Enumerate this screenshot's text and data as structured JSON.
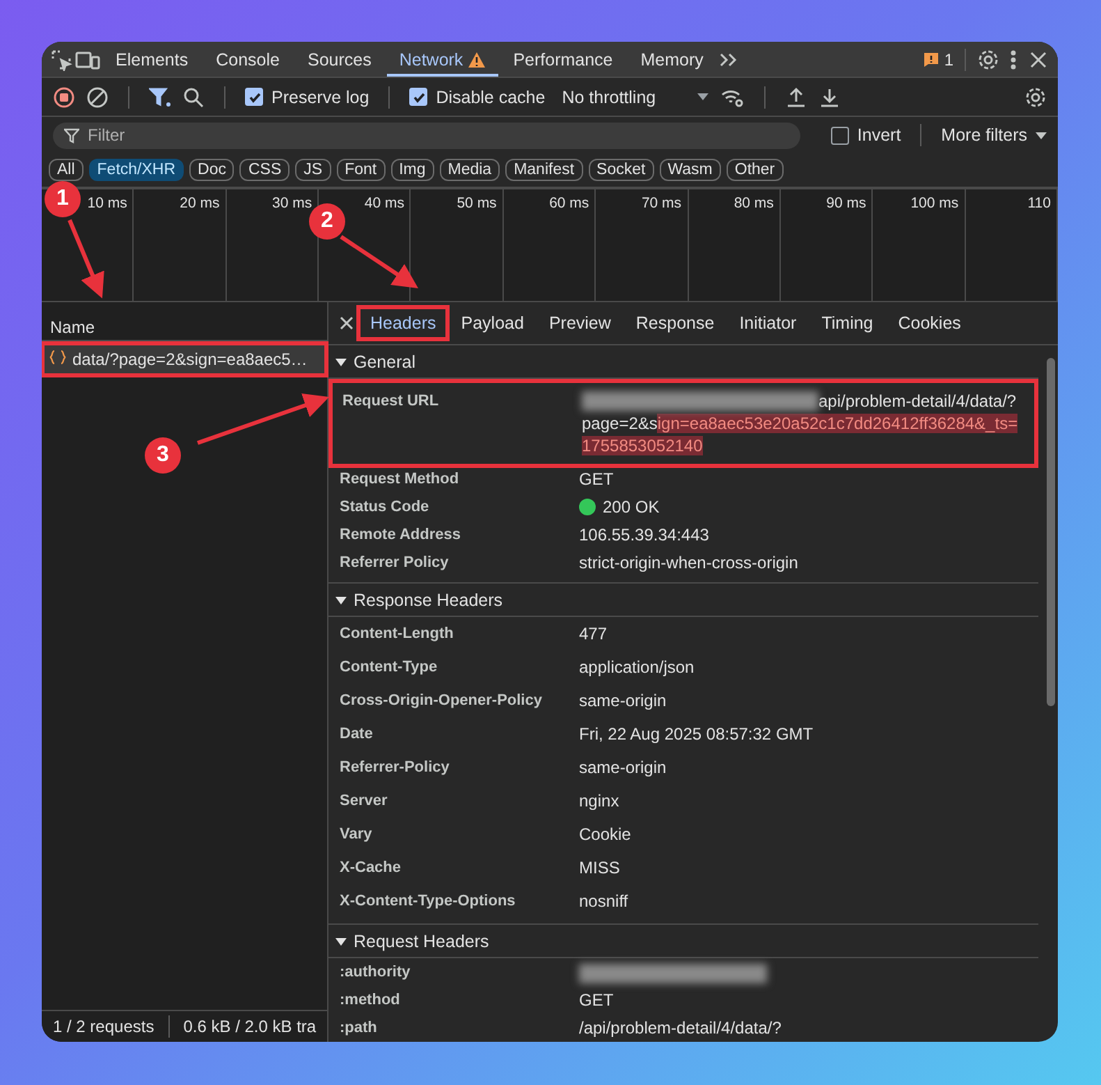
{
  "main_tabs": [
    {
      "label": "Elements",
      "selected": false,
      "warning": false
    },
    {
      "label": "Console",
      "selected": false,
      "warning": false
    },
    {
      "label": "Sources",
      "selected": false,
      "warning": false
    },
    {
      "label": "Network",
      "selected": true,
      "warning": true
    },
    {
      "label": "Performance",
      "selected": false,
      "warning": false
    },
    {
      "label": "Memory",
      "selected": false,
      "warning": false
    }
  ],
  "issues_count": "1",
  "toolbar": {
    "preserve_log": {
      "label": "Preserve log",
      "checked": true
    },
    "disable_cache": {
      "label": "Disable cache",
      "checked": true
    },
    "throttling": "No throttling"
  },
  "filter": {
    "placeholder": "Filter",
    "invert": {
      "label": "Invert",
      "checked": false
    },
    "more_filters": "More filters"
  },
  "type_filters": [
    {
      "label": "All",
      "selected": false
    },
    {
      "label": "Fetch/XHR",
      "selected": true
    },
    {
      "label": "Doc",
      "selected": false
    },
    {
      "label": "CSS",
      "selected": false
    },
    {
      "label": "JS",
      "selected": false
    },
    {
      "label": "Font",
      "selected": false
    },
    {
      "label": "Img",
      "selected": false
    },
    {
      "label": "Media",
      "selected": false
    },
    {
      "label": "Manifest",
      "selected": false
    },
    {
      "label": "Socket",
      "selected": false
    },
    {
      "label": "Wasm",
      "selected": false
    },
    {
      "label": "Other",
      "selected": false
    }
  ],
  "timeline_ticks": [
    "10 ms",
    "20 ms",
    "30 ms",
    "40 ms",
    "50 ms",
    "60 ms",
    "70 ms",
    "80 ms",
    "90 ms",
    "100 ms",
    "110"
  ],
  "requests": {
    "column": "Name",
    "rows": [
      {
        "name": "data/?page=2&sign=ea8aec5…",
        "selected": true,
        "annotated": true
      }
    ]
  },
  "status_bar": [
    "1 / 2 requests",
    "0.6 kB / 2.0 kB tra"
  ],
  "detail_tabs": [
    {
      "label": "Headers",
      "selected": true,
      "annotated": true
    },
    {
      "label": "Payload",
      "selected": false,
      "annotated": false
    },
    {
      "label": "Preview",
      "selected": false,
      "annotated": false
    },
    {
      "label": "Response",
      "selected": false,
      "annotated": false
    },
    {
      "label": "Initiator",
      "selected": false,
      "annotated": false
    },
    {
      "label": "Timing",
      "selected": false,
      "annotated": false
    },
    {
      "label": "Cookies",
      "selected": false,
      "annotated": false
    }
  ],
  "sections": [
    {
      "title": "General",
      "expanded": true,
      "kind": "general",
      "rows": [
        {
          "name": "Request URL",
          "redacted": true,
          "annotated": true,
          "parts": [
            {
              "text": "api/problem-detail/4/data/?page=2&s",
              "highlighted": false
            },
            {
              "text": "ign=ea8aec53e20a52c1c7dd26412ff36284&_ts=1755853052140",
              "highlighted": true
            }
          ]
        },
        {
          "name": "Request Method",
          "value": "GET"
        },
        {
          "name": "Status Code",
          "value": "200 OK",
          "color": "#34c759"
        },
        {
          "name": "Remote Address",
          "value": "106.55.39.34:443"
        },
        {
          "name": "Referrer Policy",
          "value": "strict-origin-when-cross-origin"
        }
      ]
    },
    {
      "title": "Response Headers",
      "expanded": true,
      "kind": "headers",
      "rows": [
        {
          "name": "Content-Length",
          "value": "477"
        },
        {
          "name": "Content-Type",
          "value": "application/json"
        },
        {
          "name": "Cross-Origin-Opener-Policy",
          "value": "same-origin"
        },
        {
          "name": "Date",
          "value": "Fri, 22 Aug 2025 08:57:32 GMT"
        },
        {
          "name": "Referrer-Policy",
          "value": "same-origin"
        },
        {
          "name": "Server",
          "value": "nginx"
        },
        {
          "name": "Vary",
          "value": "Cookie"
        },
        {
          "name": "X-Cache",
          "value": "MISS"
        },
        {
          "name": "X-Content-Type-Options",
          "value": "nosniff"
        }
      ]
    },
    {
      "title": "Request Headers",
      "expanded": true,
      "kind": "request",
      "rows": [
        {
          "name": ":authority",
          "redacted": true
        },
        {
          "name": ":method",
          "value": "GET"
        },
        {
          "name": ":path",
          "value": "/api/problem-detail/4/data/?"
        }
      ]
    }
  ],
  "annotations": [
    {
      "label": "1"
    },
    {
      "label": "2"
    },
    {
      "label": "3"
    }
  ]
}
